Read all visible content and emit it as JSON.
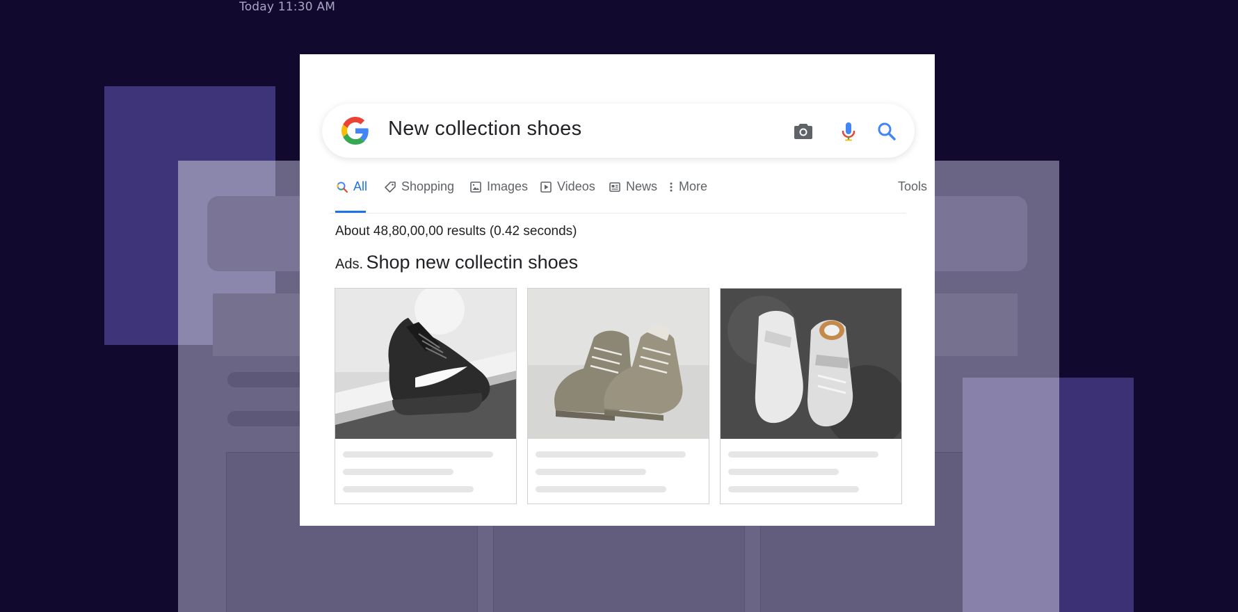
{
  "timestamp": "Today 11:30 AM",
  "search": {
    "query": "New collection shoes"
  },
  "tabs": {
    "all": "All",
    "shopping": "Shopping",
    "images": "Images",
    "videos": "Videos",
    "news": "News",
    "more": "More",
    "tools": "Tools"
  },
  "results": {
    "stats": "About 48,80,00,00 results (0.42 seconds)",
    "ads_label": "Ads.",
    "ads_title": "Shop new collectin shoes"
  },
  "icons": {
    "logo": "google-g-icon",
    "camera": "camera-icon",
    "mic": "microphone-icon",
    "search": "search-icon"
  },
  "colors": {
    "background": "#120a2e",
    "accent": "#1a73e8"
  }
}
